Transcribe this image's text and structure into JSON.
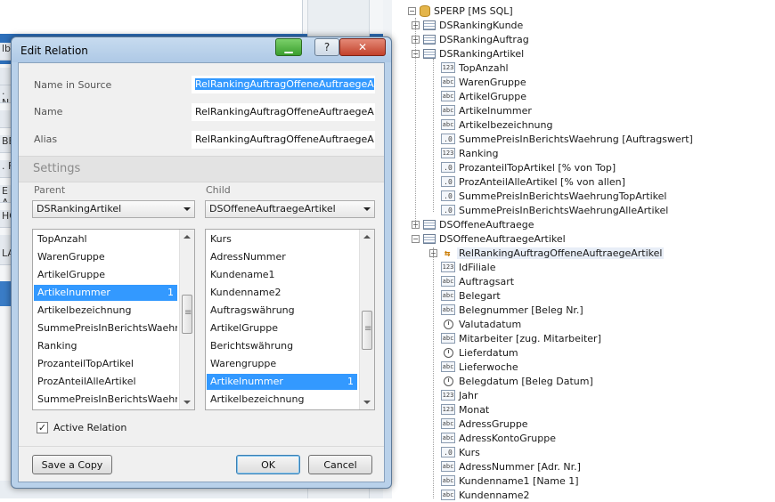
{
  "background": {
    "left_strip_texts": [
      "lb",
      "",
      ". N",
      "",
      "BE",
      ". F",
      "E A",
      "HO",
      "",
      "LA"
    ]
  },
  "tree": {
    "items": [
      {
        "label": "SPERP [MS SQL]",
        "icon": "database-icon",
        "level": 0,
        "expander": "minus"
      },
      {
        "label": "DSRankingKunde",
        "icon": "table-icon",
        "level": 1,
        "expander": "plus"
      },
      {
        "label": "DSRankingAuftrag",
        "icon": "table-icon",
        "level": 1,
        "expander": "plus"
      },
      {
        "label": "DSRankingArtikel",
        "icon": "table-icon",
        "level": 1,
        "expander": "minus"
      },
      {
        "label": "TopAnzahl",
        "icon": "int-field-icon",
        "level": 2
      },
      {
        "label": "WarenGruppe",
        "icon": "text-field-icon",
        "level": 2
      },
      {
        "label": "ArtikelGruppe",
        "icon": "text-field-icon",
        "level": 2
      },
      {
        "label": "Artikelnummer",
        "icon": "text-field-icon",
        "level": 2
      },
      {
        "label": "Artikelbezeichnung",
        "icon": "text-field-icon",
        "level": 2
      },
      {
        "label": "SummePreisInBerichtsWaehrung [Auftragswert]",
        "icon": "decimal-field-icon",
        "level": 2
      },
      {
        "label": "Ranking",
        "icon": "int-field-icon",
        "level": 2
      },
      {
        "label": "ProzanteilTopArtikel [% von Top]",
        "icon": "decimal-field-icon",
        "level": 2
      },
      {
        "label": "ProzAnteilAlleArtikel [% von allen]",
        "icon": "decimal-field-icon",
        "level": 2
      },
      {
        "label": "SummePreisInBerichtsWaehrungTopArtikel",
        "icon": "decimal-field-icon",
        "level": 2
      },
      {
        "label": "SummePreisInBerichtsWaehrungAlleArtikel",
        "icon": "decimal-field-icon",
        "level": 2
      },
      {
        "label": "DSOffeneAuftraege",
        "icon": "table-icon",
        "level": 1,
        "expander": "plus"
      },
      {
        "label": "DSOffeneAuftraegeArtikel",
        "icon": "table-icon",
        "level": 1,
        "expander": "minus"
      },
      {
        "label": "RelRankingAuftragOffeneAuftraegeArtikel",
        "icon": "relation-icon",
        "level": 2,
        "expander": "plus",
        "selected": true
      },
      {
        "label": "IdFiliale",
        "icon": "int-field-icon",
        "level": 2
      },
      {
        "label": "Auftragsart",
        "icon": "text-field-icon",
        "level": 2
      },
      {
        "label": "Belegart",
        "icon": "text-field-icon",
        "level": 2
      },
      {
        "label": "Belegnummer [Beleg Nr.]",
        "icon": "text-field-icon",
        "level": 2
      },
      {
        "label": "Valutadatum",
        "icon": "date-field-icon",
        "level": 2
      },
      {
        "label": "Mitarbeiter [zug. Mitarbeiter]",
        "icon": "text-field-icon",
        "level": 2
      },
      {
        "label": "Lieferdatum",
        "icon": "date-field-icon",
        "level": 2
      },
      {
        "label": "Lieferwoche",
        "icon": "text-field-icon",
        "level": 2
      },
      {
        "label": "Belegdatum [Beleg Datum]",
        "icon": "date-field-icon",
        "level": 2
      },
      {
        "label": "Jahr",
        "icon": "int-field-icon",
        "level": 2
      },
      {
        "label": "Monat",
        "icon": "int-field-icon",
        "level": 2
      },
      {
        "label": "AdressGruppe",
        "icon": "text-field-icon",
        "level": 2
      },
      {
        "label": "AdressKontoGruppe",
        "icon": "text-field-icon",
        "level": 2
      },
      {
        "label": "Kurs",
        "icon": "decimal-field-icon",
        "level": 2
      },
      {
        "label": "AdressNummer [Adr. Nr.]",
        "icon": "text-field-icon",
        "level": 2
      },
      {
        "label": "Kundenname1 [Name 1]",
        "icon": "text-field-icon",
        "level": 2
      },
      {
        "label": "Kundenname2",
        "icon": "text-field-icon",
        "level": 2
      }
    ],
    "icon_glyphs": {
      "int": "123",
      "text": "abc",
      "decimal": ".0"
    }
  },
  "dialog": {
    "title": "Edit Relation",
    "name_in_source_label": "Name in Source",
    "name_in_source_value": "RelRankingAuftragOffeneAuftraegeArtikel",
    "name_label": "Name",
    "name_value": "RelRankingAuftragOffeneAuftraegeArtikel",
    "alias_label": "Alias",
    "alias_value": "RelRankingAuftragOffeneAuftraegeArtikel",
    "settings_label": "Settings",
    "parent_label": "Parent",
    "child_label": "Child",
    "parent_selected": "DSRankingArtikel",
    "child_selected": "DSOffeneAuftraegeArtikel",
    "parent_columns": [
      {
        "label": "TopAnzahl"
      },
      {
        "label": "WarenGruppe"
      },
      {
        "label": "ArtikelGruppe"
      },
      {
        "label": "Artikelnummer",
        "selected": true,
        "count": "1"
      },
      {
        "label": "Artikelbezeichnung"
      },
      {
        "label": "SummePreisInBerichtsWaehru..."
      },
      {
        "label": "Ranking"
      },
      {
        "label": "ProzanteilTopArtikel"
      },
      {
        "label": "ProzAnteilAlleArtikel"
      },
      {
        "label": "SummePreisInBerichtsWaehru..."
      }
    ],
    "child_columns": [
      {
        "label": "Kurs"
      },
      {
        "label": "AdressNummer"
      },
      {
        "label": "Kundename1"
      },
      {
        "label": "Kundenname2"
      },
      {
        "label": "Auftragswährung"
      },
      {
        "label": "ArtikelGruppe"
      },
      {
        "label": "Berichtswährung"
      },
      {
        "label": "Warengruppe"
      },
      {
        "label": "Artikelnummer",
        "selected": true,
        "count": "1"
      },
      {
        "label": "Artikelbezeichnung"
      }
    ],
    "parent_scroll_position": 0.45,
    "child_scroll_position": 0.6,
    "active_relation_label": "Active Relation",
    "active_relation_checked": true,
    "save_copy_label": "Save a Copy",
    "ok_label": "OK",
    "cancel_label": "Cancel",
    "help_glyph": "?",
    "close_glyph": "✕"
  }
}
